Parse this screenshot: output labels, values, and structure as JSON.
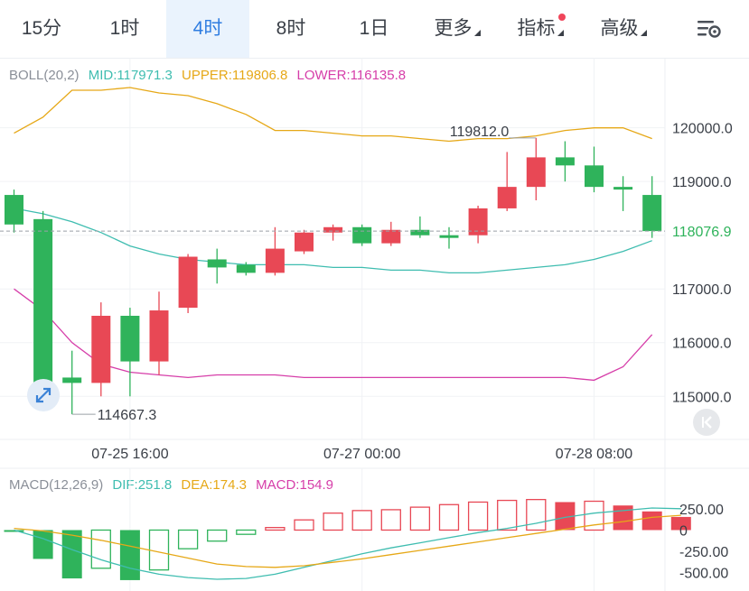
{
  "tabs": [
    {
      "label": "15分",
      "active": false
    },
    {
      "label": "1时",
      "active": false
    },
    {
      "label": "4时",
      "active": true
    },
    {
      "label": "8时",
      "active": false
    },
    {
      "label": "1日",
      "active": false
    },
    {
      "label": "更多",
      "active": false,
      "dropdown": true
    },
    {
      "label": "指标",
      "active": false,
      "dropdown": true,
      "badge": true
    },
    {
      "label": "高级",
      "active": false,
      "dropdown": true
    }
  ],
  "settings_icon": "chart-settings-icon",
  "boll_legend": {
    "name": "BOLL(20,2)",
    "mid": "MID:117971.3",
    "upper": "UPPER:119806.8",
    "lower": "LOWER:116135.8"
  },
  "macd_legend": {
    "name": "MACD(12,26,9)",
    "dif": "DIF:251.8",
    "dea": "DEA:174.3",
    "macd": "MACD:154.9"
  },
  "colors": {
    "up": "#e84855",
    "down": "#2fb35b",
    "mid": "#3fbdb0",
    "upper": "#e6a817",
    "lower": "#d63ea9",
    "dif": "#3fbdb0",
    "dea": "#e6a817",
    "accent": "#2f7de1"
  },
  "price_labels": {
    "high": "119812.0",
    "low": "114667.3",
    "current": "118076.9"
  },
  "chart_data": [
    {
      "type": "candlestick",
      "title": "",
      "yticks": [
        "120000.0",
        "119000.0",
        "118000.0",
        "117000.0",
        "116000.0",
        "115000.0"
      ],
      "ytick_values": [
        120000,
        119000,
        118000,
        117000,
        116000,
        115000
      ],
      "xticks": [
        "07-25 16:00",
        "07-27 00:00",
        "07-28 08:00"
      ],
      "xtick_index": [
        4,
        12,
        20
      ],
      "ylim": [
        114450,
        120700
      ],
      "candles": [
        {
          "o": 118750,
          "c": 118200,
          "h": 118850,
          "l": 118050
        },
        {
          "o": 118300,
          "c": 115250,
          "h": 118450,
          "l": 115150
        },
        {
          "o": 115350,
          "c": 115250,
          "h": 115850,
          "l": 114667.3
        },
        {
          "o": 115250,
          "c": 116500,
          "h": 116750,
          "l": 115000
        },
        {
          "o": 116500,
          "c": 115650,
          "h": 116650,
          "l": 115000
        },
        {
          "o": 115650,
          "c": 116600,
          "h": 116950,
          "l": 115400
        },
        {
          "o": 116650,
          "c": 117600,
          "h": 117650,
          "l": 116550
        },
        {
          "o": 117550,
          "c": 117400,
          "h": 117750,
          "l": 117100
        },
        {
          "o": 117450,
          "c": 117300,
          "h": 117500,
          "l": 117250
        },
        {
          "o": 117300,
          "c": 117750,
          "h": 118150,
          "l": 117250
        },
        {
          "o": 117700,
          "c": 118050,
          "h": 118100,
          "l": 117650
        },
        {
          "o": 118050,
          "c": 118150,
          "h": 118200,
          "l": 117900
        },
        {
          "o": 118150,
          "c": 117850,
          "h": 118200,
          "l": 117800
        },
        {
          "o": 117850,
          "c": 118100,
          "h": 118250,
          "l": 117800
        },
        {
          "o": 118100,
          "c": 118000,
          "h": 118350,
          "l": 117950
        },
        {
          "o": 118000,
          "c": 117950,
          "h": 118150,
          "l": 117750
        },
        {
          "o": 118000,
          "c": 118500,
          "h": 118550,
          "l": 117850
        },
        {
          "o": 118500,
          "c": 118900,
          "h": 119550,
          "l": 118450
        },
        {
          "o": 118900,
          "c": 119450,
          "h": 119812,
          "l": 118650
        },
        {
          "o": 119450,
          "c": 119300,
          "h": 119750,
          "l": 119000
        },
        {
          "o": 119300,
          "c": 118900,
          "h": 119650,
          "l": 118800
        },
        {
          "o": 118900,
          "c": 118850,
          "h": 119100,
          "l": 118450
        },
        {
          "o": 118750,
          "c": 118076.9,
          "h": 119100,
          "l": 117950
        }
      ],
      "boll_mid": [
        118500,
        118400,
        118250,
        118050,
        117800,
        117650,
        117550,
        117500,
        117450,
        117450,
        117450,
        117400,
        117400,
        117350,
        117350,
        117300,
        117300,
        117350,
        117400,
        117450,
        117550,
        117700,
        117900
      ],
      "boll_upper": [
        119900,
        120200,
        120700,
        120700,
        120750,
        120650,
        120600,
        120450,
        120250,
        119950,
        119950,
        119900,
        119850,
        119850,
        119800,
        119750,
        119800,
        119800,
        119850,
        119950,
        120000,
        120000,
        119800
      ],
      "boll_lower": [
        117000,
        116600,
        116000,
        115600,
        115450,
        115400,
        115350,
        115400,
        115400,
        115400,
        115350,
        115350,
        115350,
        115350,
        115350,
        115350,
        115350,
        115350,
        115350,
        115350,
        115300,
        115550,
        116150
      ]
    },
    {
      "type": "bar",
      "title": "",
      "yticks": [
        "250.00",
        "0",
        "-250.00",
        "-500.00"
      ],
      "ytick_values": [
        250,
        0,
        -250,
        -500
      ],
      "ylim": [
        -580,
        420
      ],
      "macd": [
        -10,
        -340,
        -570,
        -450,
        -590,
        -470,
        -220,
        -130,
        -50,
        30,
        120,
        200,
        230,
        240,
        270,
        300,
        330,
        350,
        360,
        330,
        340,
        290,
        220,
        155
      ],
      "dif": [
        0,
        -100,
        -230,
        -350,
        -450,
        -520,
        -560,
        -580,
        -570,
        -520,
        -440,
        -360,
        -280,
        -210,
        -150,
        -90,
        -30,
        20,
        80,
        150,
        200,
        230,
        260,
        252
      ],
      "dea": [
        20,
        -10,
        -60,
        -120,
        -190,
        -260,
        -330,
        -400,
        -430,
        -440,
        -420,
        -380,
        -340,
        -290,
        -240,
        -190,
        -140,
        -90,
        -40,
        10,
        60,
        100,
        150,
        174
      ]
    }
  ]
}
